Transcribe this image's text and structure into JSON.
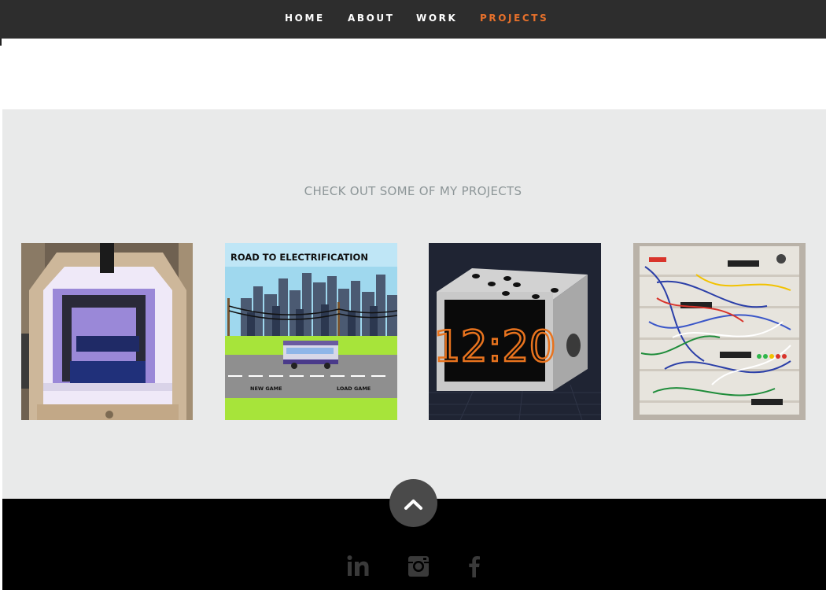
{
  "nav": {
    "items": [
      {
        "label": "HOME",
        "active": false
      },
      {
        "label": "ABOUT",
        "active": false
      },
      {
        "label": "WORK",
        "active": false
      },
      {
        "label": "PROJECTS",
        "active": true
      }
    ],
    "active_color": "#e8712b"
  },
  "projects": {
    "title": "CHECK OUT SOME OF MY PROJECTS",
    "items": [
      {
        "icon": "3d-printer-enclosure-photo"
      },
      {
        "icon": "road-to-electrification-game-screenshot",
        "game_title": "ROAD TO ELECTRIFICATION",
        "new_game": "NEW GAME",
        "load_game": "LOAD GAME"
      },
      {
        "icon": "digital-clock-render",
        "clock_time": "12:20"
      },
      {
        "icon": "breadboard-circuit-photo"
      }
    ]
  },
  "footer": {
    "scroll_top_icon": "chevron-up-icon",
    "social": [
      "linkedin-icon",
      "instagram-icon",
      "facebook-icon"
    ],
    "social_icon_color": "#3a3a3a"
  }
}
